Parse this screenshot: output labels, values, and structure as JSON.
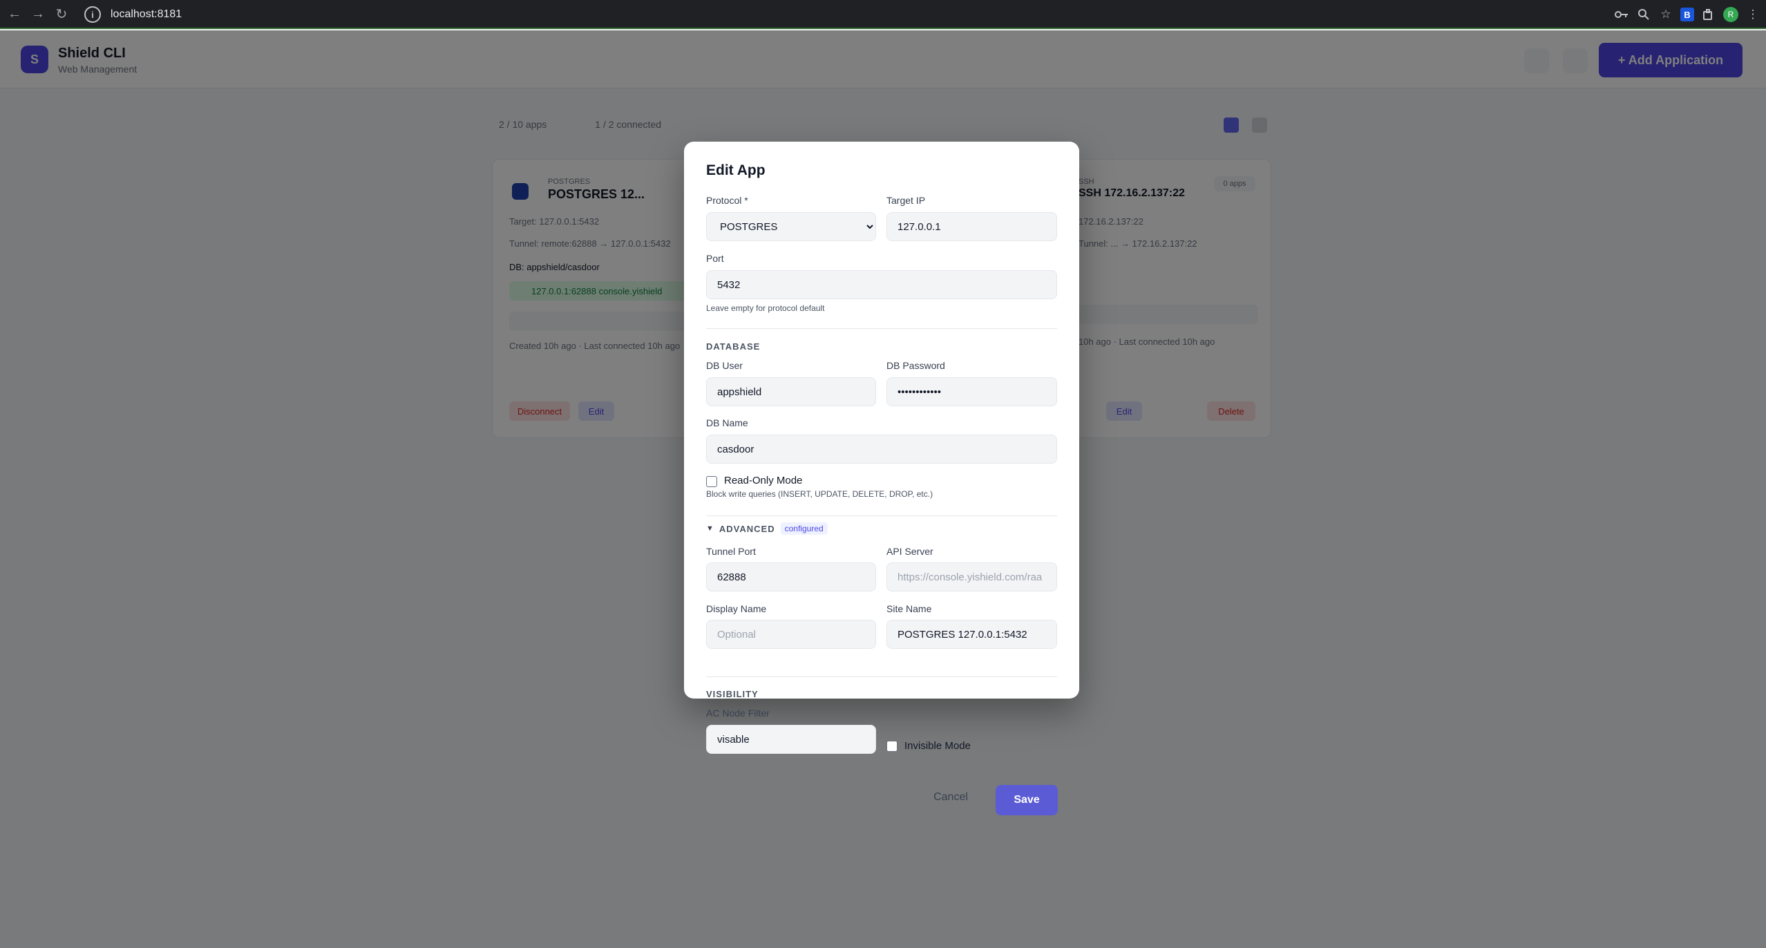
{
  "browser": {
    "url": "localhost:8181",
    "back_icon": "←",
    "forward_icon": "→",
    "reload_icon": "↻",
    "avatar_initial": "R",
    "ext_label": "B"
  },
  "app": {
    "logo_letter": "S",
    "title": "Shield CLI",
    "subtitle": "Web Management",
    "add_button": "+ Add Application",
    "stats_apps": "2 / 10 apps",
    "stats_connected": "1 / 2 connected"
  },
  "cards": {
    "left": {
      "protocol": "POSTGRES",
      "title": "POSTGRES 12...",
      "target": "Target: 127.0.0.1:5432",
      "tunnel": "Tunnel: remote:62888 → 127.0.0.1:5432",
      "db": "DB: appshield/casdoor",
      "link": "127.0.0.1:62888 console.yishield",
      "meta": "Created 10h ago · Last connected 10h ago",
      "disconnect": "Disconnect",
      "edit": "Edit"
    },
    "right": {
      "protocol": "SSH",
      "title": "SSH 172.16.2.137:22",
      "target": "172.16.2.137:22",
      "tunnel": "Tunnel: ... → 172.16.2.137:22",
      "meta": "10h ago · Last connected 10h ago",
      "badge": "0 apps",
      "edit": "Edit",
      "delete": "Delete"
    }
  },
  "modal": {
    "title": "Edit App",
    "protocol_label": "Protocol *",
    "protocol_value": "POSTGRES",
    "target_ip_label": "Target IP",
    "target_ip_value": "127.0.0.1",
    "port_label": "Port",
    "port_value": "5432",
    "port_hint": "Leave empty for protocol default",
    "database_section": "DATABASE",
    "db_user_label": "DB User",
    "db_user_value": "appshield",
    "db_password_label": "DB Password",
    "db_password_value": "••••••••••••",
    "db_name_label": "DB Name",
    "db_name_value": "casdoor",
    "readonly_label": "Read-Only Mode",
    "readonly_hint": "Block write queries (INSERT, UPDATE, DELETE, DROP, etc.)",
    "advanced_arrow": "▼",
    "advanced_section": "ADVANCED",
    "advanced_badge": "configured",
    "tunnel_port_label": "Tunnel Port",
    "tunnel_port_value": "62888",
    "api_server_label": "API Server",
    "api_server_placeholder": "https://console.yishield.com/raa",
    "display_name_label": "Display Name",
    "display_name_placeholder": "Optional",
    "site_name_label": "Site Name",
    "site_name_value": "POSTGRES 127.0.0.1:5432",
    "visibility_section": "VISIBILITY",
    "ac_filter_label": "AC Node Filter",
    "ac_filter_value": "visable",
    "invisible_label": "Invisible Mode",
    "cancel_label": "Cancel",
    "save_label": "Save"
  }
}
